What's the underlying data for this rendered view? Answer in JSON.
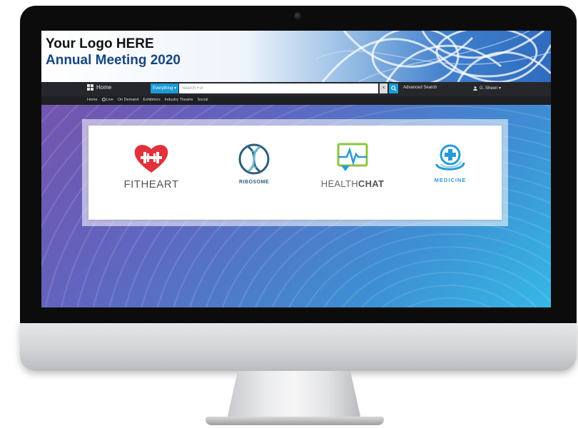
{
  "banner": {
    "logo_line1": "Your Logo HERE",
    "logo_line2": "Annual Meeting 2020"
  },
  "navbar": {
    "home_label": "Home",
    "scope_label": "Everything ▾",
    "search_placeholder": "Search For",
    "clear_label": "×",
    "advanced_search": "Advanced Search",
    "user_label": "G. Sheen ▾"
  },
  "subnav": {
    "items": [
      "Home",
      "Live",
      "On Demand",
      "Exhibitors",
      "Industry Theatre",
      "Social"
    ]
  },
  "sponsors": [
    {
      "name_part1": "FITHEART",
      "name_part2": "",
      "icon": "heart-barbell-icon",
      "color": "#e0313c"
    },
    {
      "name_part1": "RIBOSOME",
      "name_part2": "",
      "icon": "dna-helix-icon",
      "color": "#2e5e7a"
    },
    {
      "name_part1": "HEALTH",
      "name_part2": "CHAT",
      "icon": "heartbeat-chat-icon",
      "color": "#8cc63f"
    },
    {
      "name_part1": "MEDICINE",
      "name_part2": "",
      "icon": "medical-cross-icon",
      "color": "#2a9ad6"
    }
  ],
  "colors": {
    "accent": "#1b9bd7",
    "navbar": "#25272b",
    "title_blue": "#17467f"
  }
}
